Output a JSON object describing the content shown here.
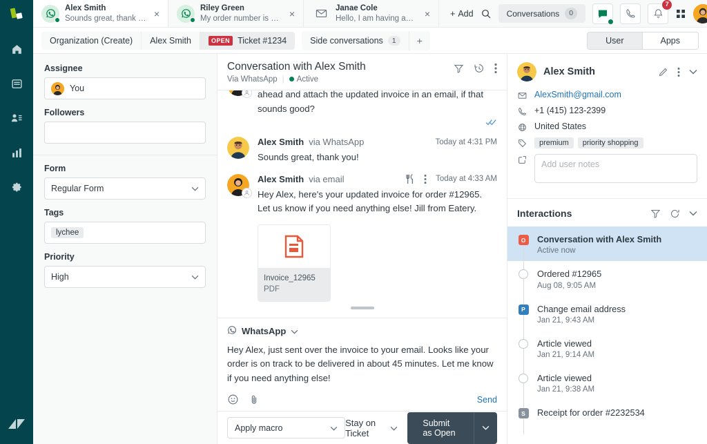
{
  "brand": {
    "nav_bg": "#04444d",
    "accent_blue": "#1f73b7",
    "open_red": "#cc3340",
    "green": "#038153",
    "submit_dark": "#3b4b58"
  },
  "left_nav": {
    "items": [
      {
        "name": "home",
        "label": "Home"
      },
      {
        "name": "views",
        "label": "Views"
      },
      {
        "name": "customers",
        "label": "Customers"
      },
      {
        "name": "reporting",
        "label": "Reporting"
      },
      {
        "name": "admin",
        "label": "Admin"
      }
    ],
    "logo": "zendesk-logo"
  },
  "topbar": {
    "conversation_tabs": [
      {
        "name": "Alex Smith",
        "snippet": "Sounds great, thank you!",
        "channel": "whatsapp",
        "active": true,
        "online": true
      },
      {
        "name": "Riley Green",
        "snippet": "My order number is 19...",
        "channel": "whatsapp",
        "active": false,
        "online": true
      },
      {
        "name": "Janae Cole",
        "snippet": "Hello, I am having an is...",
        "channel": "email",
        "active": false,
        "online": false
      }
    ],
    "close_label": "×",
    "add_label": "Add",
    "add_plus": "+",
    "conversations_pill": {
      "label": "Conversations",
      "count": "0"
    },
    "notification_count": "7"
  },
  "crumbbar": {
    "items": [
      {
        "label": "Organization (Create)",
        "badge": null,
        "selected": false
      },
      {
        "label": "Alex Smith",
        "badge": null,
        "selected": false
      },
      {
        "label": "Ticket #1234",
        "badge": "OPEN",
        "selected": true
      }
    ],
    "side_conversations": {
      "label": "Side conversations",
      "count": "1",
      "plus": "+"
    },
    "segments": [
      {
        "label": "User",
        "active": true
      },
      {
        "label": "Apps",
        "active": false
      }
    ]
  },
  "properties": {
    "assignee": {
      "label": "Assignee",
      "value": "You"
    },
    "followers": {
      "label": "Followers",
      "value": ""
    },
    "form": {
      "label": "Form",
      "value": "Regular Form"
    },
    "tags": {
      "label": "Tags",
      "values": [
        "lychee"
      ]
    },
    "priority": {
      "label": "Priority",
      "value": "High"
    }
  },
  "conversation": {
    "title": "Conversation with Alex Smith",
    "via": "Via WhatsApp",
    "status": "Active",
    "messages": [
      {
        "author": "",
        "via": "",
        "time": "",
        "text": "Hey Alex, we’ve gone ahead and updated your order. I’ll go ahead and attach the updated invoice in an email, if that sounds good?",
        "avatar": "agent",
        "read_receipt": true,
        "show_header": false
      },
      {
        "author": "Alex Smith",
        "via": "via WhatsApp",
        "time": "Today at 4:31 PM",
        "text": "Sounds great, thank you!",
        "avatar": "customer",
        "read_receipt": false,
        "show_header": true
      },
      {
        "author": "Alex Smith",
        "via": "via email",
        "time": "Today at 4:33 AM",
        "text": "Hey Alex, here's your updated invoice for order #12965. Let us know if you need anything else! Jill from Eatery.",
        "avatar": "agent",
        "read_receipt": false,
        "show_header": true,
        "has_menu_icons": true,
        "attachment": {
          "name": "Invoice_12965",
          "type": "PDF"
        }
      }
    ],
    "composer": {
      "channel": "WhatsApp",
      "text": "Hey Alex, just sent over the invoice to your email. Looks like your order is on track to be delivered in about 45 minutes. Let me know if you need anything else!",
      "send_label": "Send"
    }
  },
  "footer": {
    "macro_placeholder": "Apply macro",
    "stay_on_ticket": "Stay on Ticket",
    "submit_label": "Submit as Open"
  },
  "context": {
    "user": {
      "name": "Alex Smith",
      "email": "AlexSmith@gmail.com",
      "phone": "+1 (415) 123-2399",
      "country": "United States",
      "tags": [
        "premium",
        "priority shopping"
      ],
      "notes_placeholder": "Add user notes"
    },
    "interactions": {
      "title": "Interactions",
      "items": [
        {
          "title": "Conversation with Alex Smith",
          "sub": "Active now",
          "node": "square",
          "node_char": "O",
          "node_color": "#ed5c47",
          "selected": true
        },
        {
          "title": "Ordered #12965",
          "sub": "Aug 08, 9:05 AM",
          "node": "circle",
          "node_char": "",
          "node_color": "",
          "selected": false
        },
        {
          "title": "Change email address",
          "sub": "Jan 21, 9:43 AM",
          "node": "square",
          "node_char": "P",
          "node_color": "#337fbd",
          "selected": false
        },
        {
          "title": "Article viewed",
          "sub": "Jan 21, 9:14 AM",
          "node": "circle",
          "node_char": "",
          "node_color": "",
          "selected": false
        },
        {
          "title": "Article viewed",
          "sub": "Jan 21, 9:38 AM",
          "node": "circle",
          "node_char": "",
          "node_color": "",
          "selected": false
        },
        {
          "title": "Receipt for order #2232534",
          "sub": "",
          "node": "square",
          "node_char": "S",
          "node_color": "#87929d",
          "selected": false
        }
      ]
    }
  }
}
